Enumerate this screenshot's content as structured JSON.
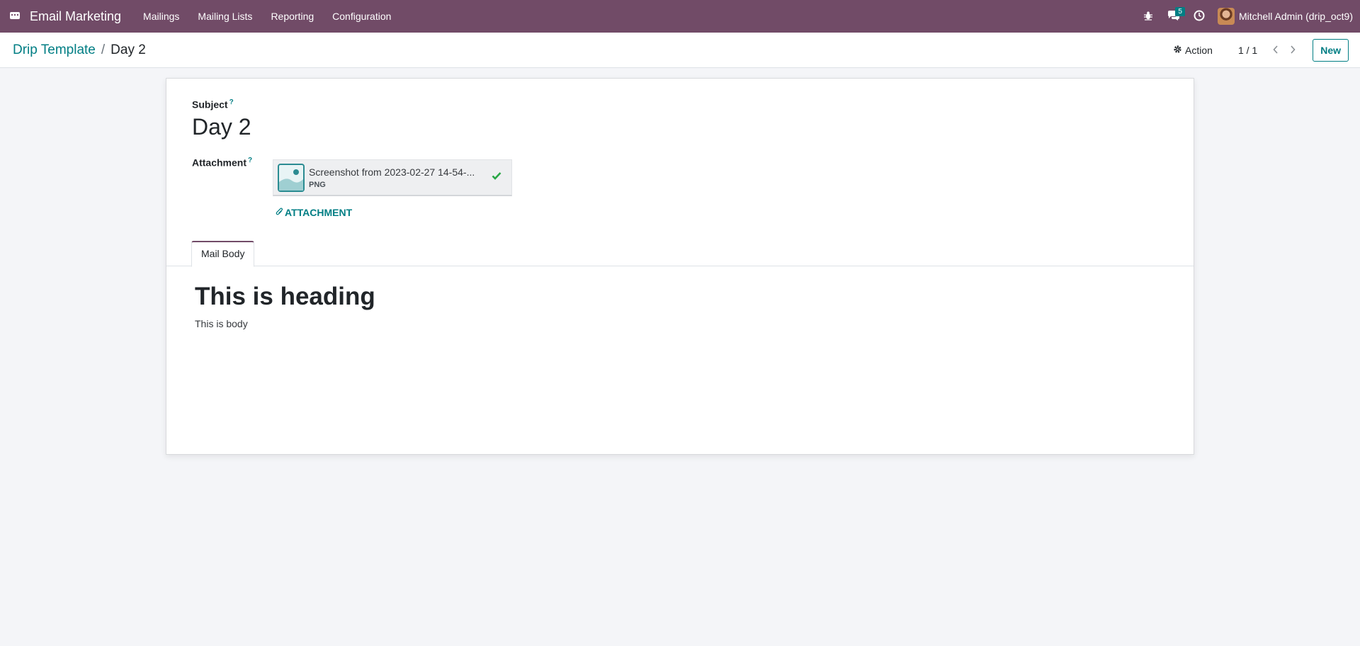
{
  "navbar": {
    "app_name": "Email Marketing",
    "menu": [
      "Mailings",
      "Mailing Lists",
      "Reporting",
      "Configuration"
    ],
    "messages_badge": "5",
    "user_name": "Mitchell Admin (drip_oct9)"
  },
  "breadcrumb": {
    "parent": "Drip Template",
    "current": "Day 2"
  },
  "control_panel": {
    "action_label": "Action",
    "pager_value": "1 / 1",
    "new_label": "New"
  },
  "form": {
    "subject_label": "Subject",
    "subject_value": "Day 2",
    "attachment_label": "Attachment",
    "help_mark": "?",
    "attachment": {
      "file_name": "Screenshot from 2023-02-27 14-54-...",
      "file_ext": "PNG"
    },
    "add_attachment_label": "ATTACHMENT",
    "tab_label": "Mail Body",
    "body_heading": "This is heading",
    "body_text": "This is body"
  },
  "colors": {
    "navbar": "#714b67",
    "accent": "#017e84",
    "success": "#28a745"
  },
  "icons": [
    "apps-icon",
    "bug-icon",
    "chat-icon",
    "clock-icon",
    "gear-icon",
    "chevron-left-icon",
    "chevron-right-icon",
    "image-file-icon",
    "checkmark-icon",
    "paperclip-icon"
  ]
}
